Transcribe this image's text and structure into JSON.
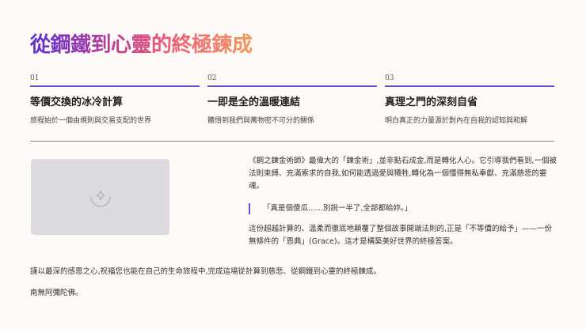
{
  "title": "從鋼鐵到心靈的終極鍊成",
  "columns": [
    {
      "num": "01",
      "heading": "等價交換的冰冷計算",
      "sub": "旅程始於一個由規則與交易支配的世界"
    },
    {
      "num": "02",
      "heading": "一即是全的溫暖連結",
      "sub": "體悟到我們與萬物密不可分的關係"
    },
    {
      "num": "03",
      "heading": "真理之門的深刻自省",
      "sub": "明白真正的力量源於對內在自我的認知與和解"
    }
  ],
  "image": {
    "icon": "sparkle-loading-icon"
  },
  "paragraph1": "《鋼之鍊金術師》最偉大的「鍊金術」,並非點石成金,而是轉化人心。它引導我們看到,一個被法則束縛、充滿索求的自我,如何能透過愛與犧牲,轉化為一個懂得無私奉獻、充滿慈悲的靈魂。",
  "quote": "「真是個傻瓜……別說一半了,全部都給妳。」",
  "paragraph2": "這份超越計算的、溫柔而徹底地顛覆了整個故事開端法則的,正是「不等價的給予」——一份無條件的「恩典」(Grace)。這才是構築美好世界的終極答案。",
  "closing": "謹以最深的感恩之心,祝福您也能在自己的生命旅程中,完成這場從計算到慈悲、從鋼鐵到心靈的終極鍊成。",
  "blessing": "南無阿彌陀佛。"
}
